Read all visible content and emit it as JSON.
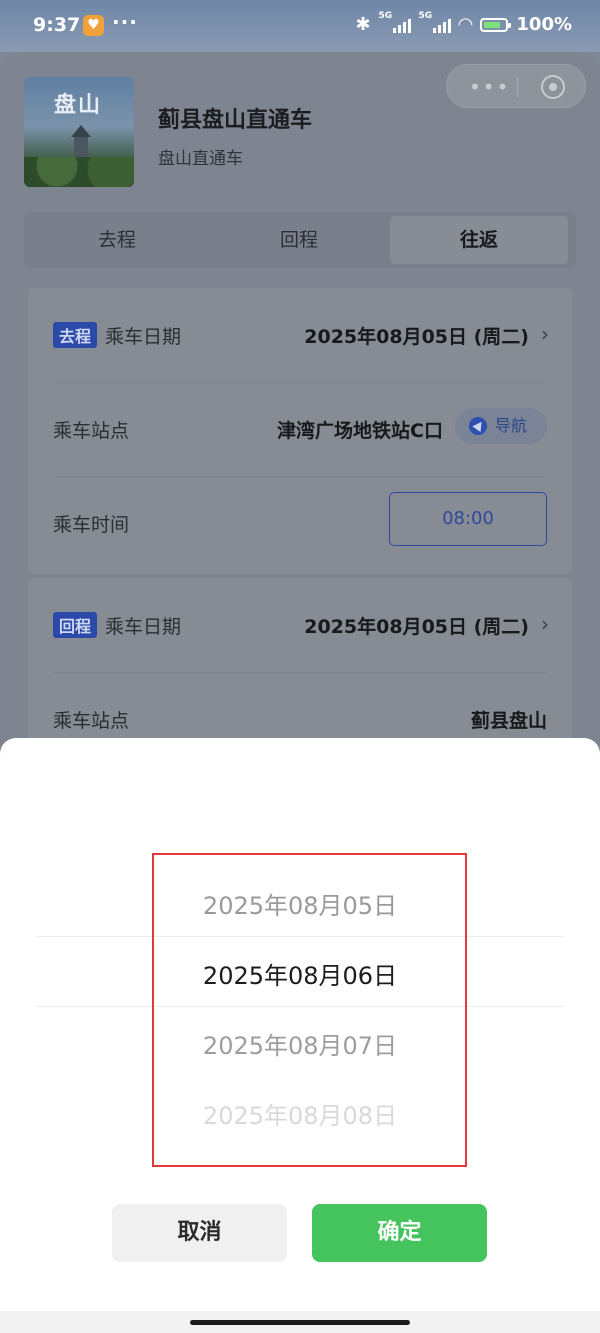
{
  "status_bar": {
    "time": "9:37",
    "app_badge": "♥",
    "more": "···",
    "net1": "5G",
    "net2": "5G",
    "battery": "100%"
  },
  "header": {
    "thumbnail_text": "盘山",
    "title": "蓟县盘山直通车",
    "subtitle": "盘山直通车"
  },
  "tabs": [
    {
      "label": "去程",
      "active": false
    },
    {
      "label": "回程",
      "active": false
    },
    {
      "label": "往返",
      "active": true
    }
  ],
  "outbound": {
    "badge": "去程",
    "date_label": "乘车日期",
    "date_value": "2025年08月05日 (周二)",
    "station_label": "乘车站点",
    "station_value": "津湾广场地铁站C口",
    "nav_label": "导航",
    "time_label": "乘车时间",
    "time_value": "08:00"
  },
  "return": {
    "badge": "回程",
    "date_label": "乘车日期",
    "date_value": "2025年08月05日 (周二)",
    "station_label": "乘车站点",
    "station_value": "蓟县盘山"
  },
  "picker": {
    "options": [
      "2025年08月05日",
      "2025年08月06日",
      "2025年08月07日",
      "2025年08月08日"
    ],
    "selected": "2025年08月06日",
    "cancel_label": "取消",
    "confirm_label": "确定"
  },
  "colors": {
    "confirm": "#45c35d",
    "badge": "#2a49a8",
    "highlight_box": "#e3373a"
  }
}
